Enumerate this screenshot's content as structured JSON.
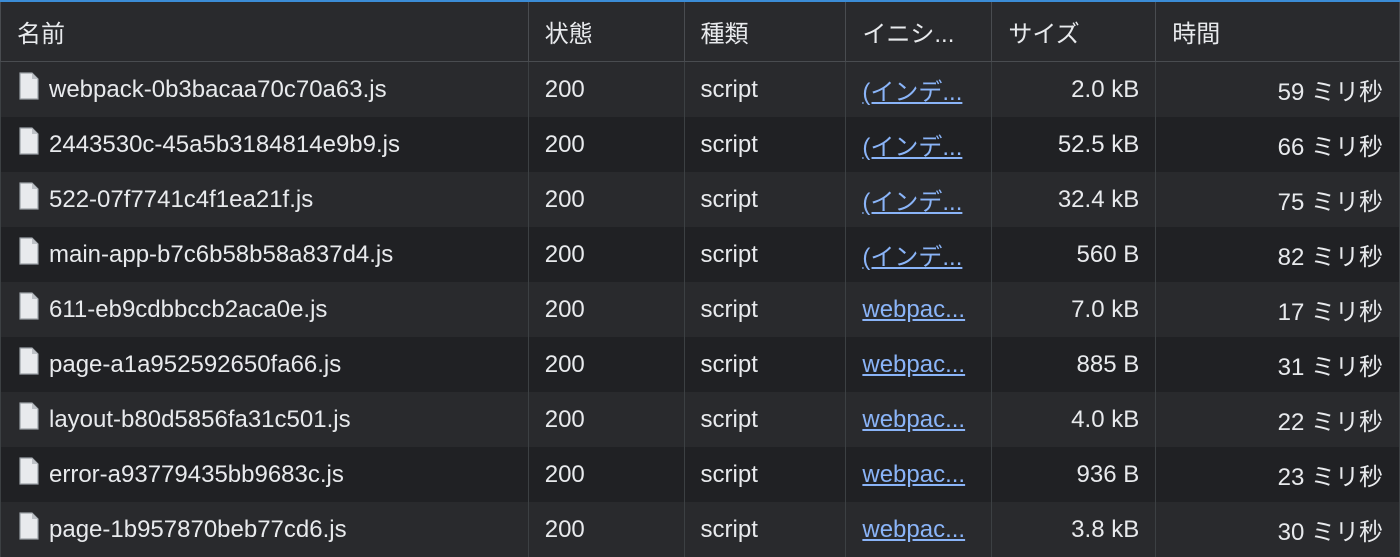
{
  "columns": {
    "name": "名前",
    "status": "状態",
    "type": "種類",
    "initiator": "イニシ...",
    "size": "サイズ",
    "time": "時間"
  },
  "rows": [
    {
      "name": "webpack-0b3bacaa70c70a63.js",
      "status": "200",
      "type": "script",
      "initiator": "(インデ...",
      "size": "2.0 kB",
      "time": "59 ミリ秒"
    },
    {
      "name": "2443530c-45a5b3184814e9b9.js",
      "status": "200",
      "type": "script",
      "initiator": "(インデ...",
      "size": "52.5 kB",
      "time": "66 ミリ秒"
    },
    {
      "name": "522-07f7741c4f1ea21f.js",
      "status": "200",
      "type": "script",
      "initiator": "(インデ...",
      "size": "32.4 kB",
      "time": "75 ミリ秒"
    },
    {
      "name": "main-app-b7c6b58b58a837d4.js",
      "status": "200",
      "type": "script",
      "initiator": "(インデ...",
      "size": "560 B",
      "time": "82 ミリ秒"
    },
    {
      "name": "611-eb9cdbbccb2aca0e.js",
      "status": "200",
      "type": "script",
      "initiator": "webpac...",
      "size": "7.0 kB",
      "time": "17 ミリ秒"
    },
    {
      "name": "page-a1a952592650fa66.js",
      "status": "200",
      "type": "script",
      "initiator": "webpac...",
      "size": "885 B",
      "time": "31 ミリ秒"
    },
    {
      "name": "layout-b80d5856fa31c501.js",
      "status": "200",
      "type": "script",
      "initiator": "webpac...",
      "size": "4.0 kB",
      "time": "22 ミリ秒"
    },
    {
      "name": "error-a93779435bb9683c.js",
      "status": "200",
      "type": "script",
      "initiator": "webpac...",
      "size": "936 B",
      "time": "23 ミリ秒"
    },
    {
      "name": "page-1b957870beb77cd6.js",
      "status": "200",
      "type": "script",
      "initiator": "webpac...",
      "size": "3.8 kB",
      "time": "30 ミリ秒"
    }
  ]
}
